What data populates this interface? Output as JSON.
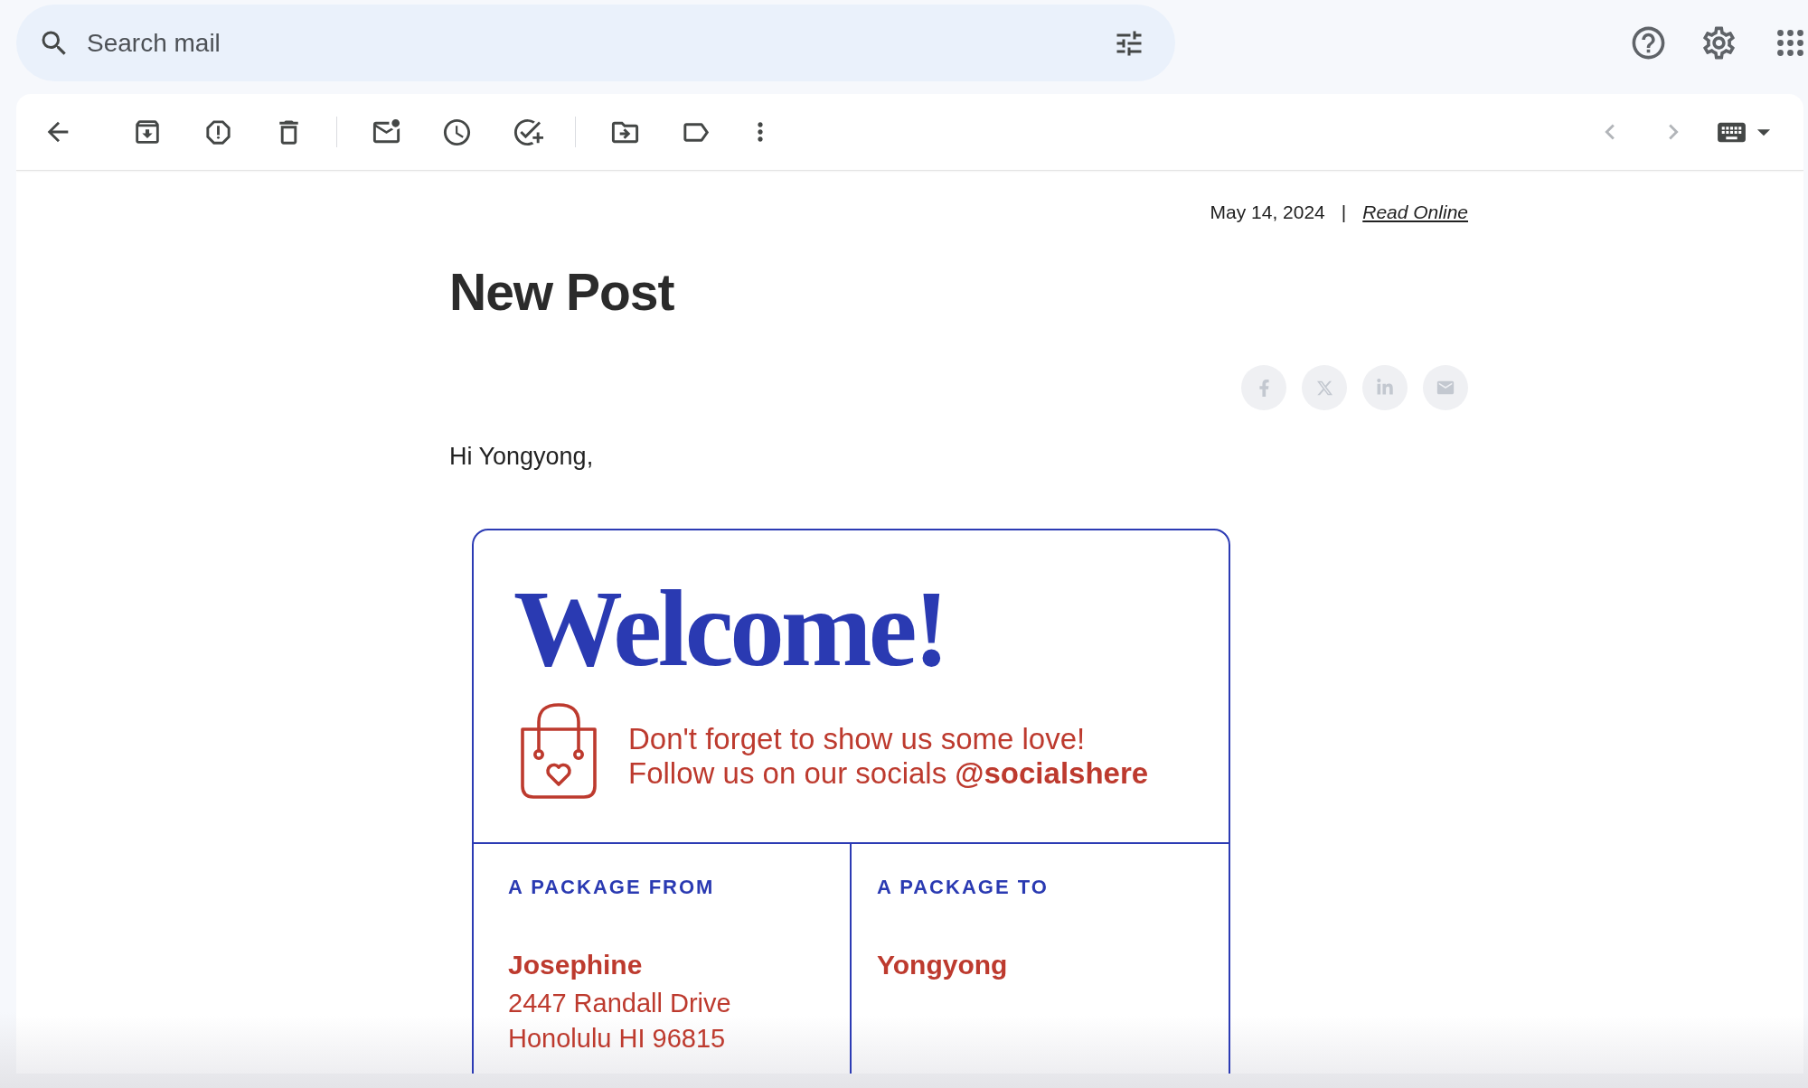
{
  "search": {
    "placeholder": "Search mail"
  },
  "pager": {
    "previous": {
      "disabled": true
    },
    "next": {
      "disabled": true
    }
  },
  "email": {
    "date": "May 14, 2024",
    "separator": "|",
    "read_online": "Read Online",
    "title": "New Post",
    "greeting": "Hi Yongyong,"
  },
  "card": {
    "heading": "Welcome!",
    "message": [
      "Don't forget to show us some love!",
      "Follow us on our socials **@socialshere**"
    ],
    "columns": [
      {
        "label": "A PACKAGE FROM",
        "name": "Josephine",
        "address": [
          "2447 Randall Drive",
          "Honolulu HI 96815"
        ]
      },
      {
        "label": "A PACKAGE TO",
        "name": "Yongyong"
      }
    ]
  }
}
